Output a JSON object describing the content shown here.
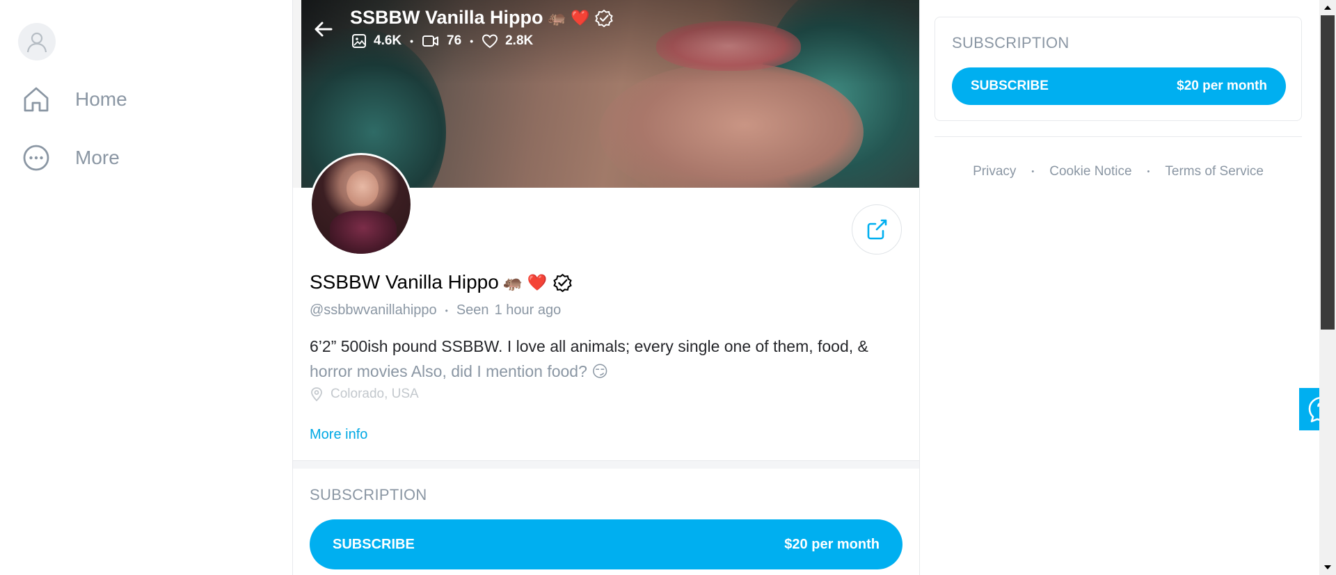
{
  "sidebar": {
    "avatar_icon": "user-icon",
    "items": [
      {
        "label": "Home",
        "icon": "home-icon"
      },
      {
        "label": "More",
        "icon": "more-icon"
      }
    ]
  },
  "cover": {
    "title": "SSBBW Vanilla Hippo",
    "title_emojis": "🦛 ❤️",
    "stats": {
      "images": "4.6K",
      "videos": "76",
      "likes": "2.8K"
    }
  },
  "profile": {
    "name": "SSBBW Vanilla Hippo",
    "name_emojis": "🦛 ❤️",
    "handle": "@ssbbwvanillahippo",
    "seen_label": "Seen",
    "seen_time": "1 hour ago",
    "bio_line1": "6’2” 500ish pound SSBBW. I love all animals; every single one of them, food, &",
    "bio_line2": "horror movies Also, did I mention food? 😏",
    "location": "Colorado, USA",
    "more_info": "More info"
  },
  "subscription": {
    "title": "SUBSCRIPTION",
    "button_label": "SUBSCRIBE",
    "price": "$20 per month"
  },
  "footer": {
    "privacy": "Privacy",
    "cookie": "Cookie Notice",
    "terms": "Terms of Service"
  },
  "colors": {
    "accent": "#00aff0",
    "muted": "#8a96a3",
    "link": "#00a8e4"
  }
}
